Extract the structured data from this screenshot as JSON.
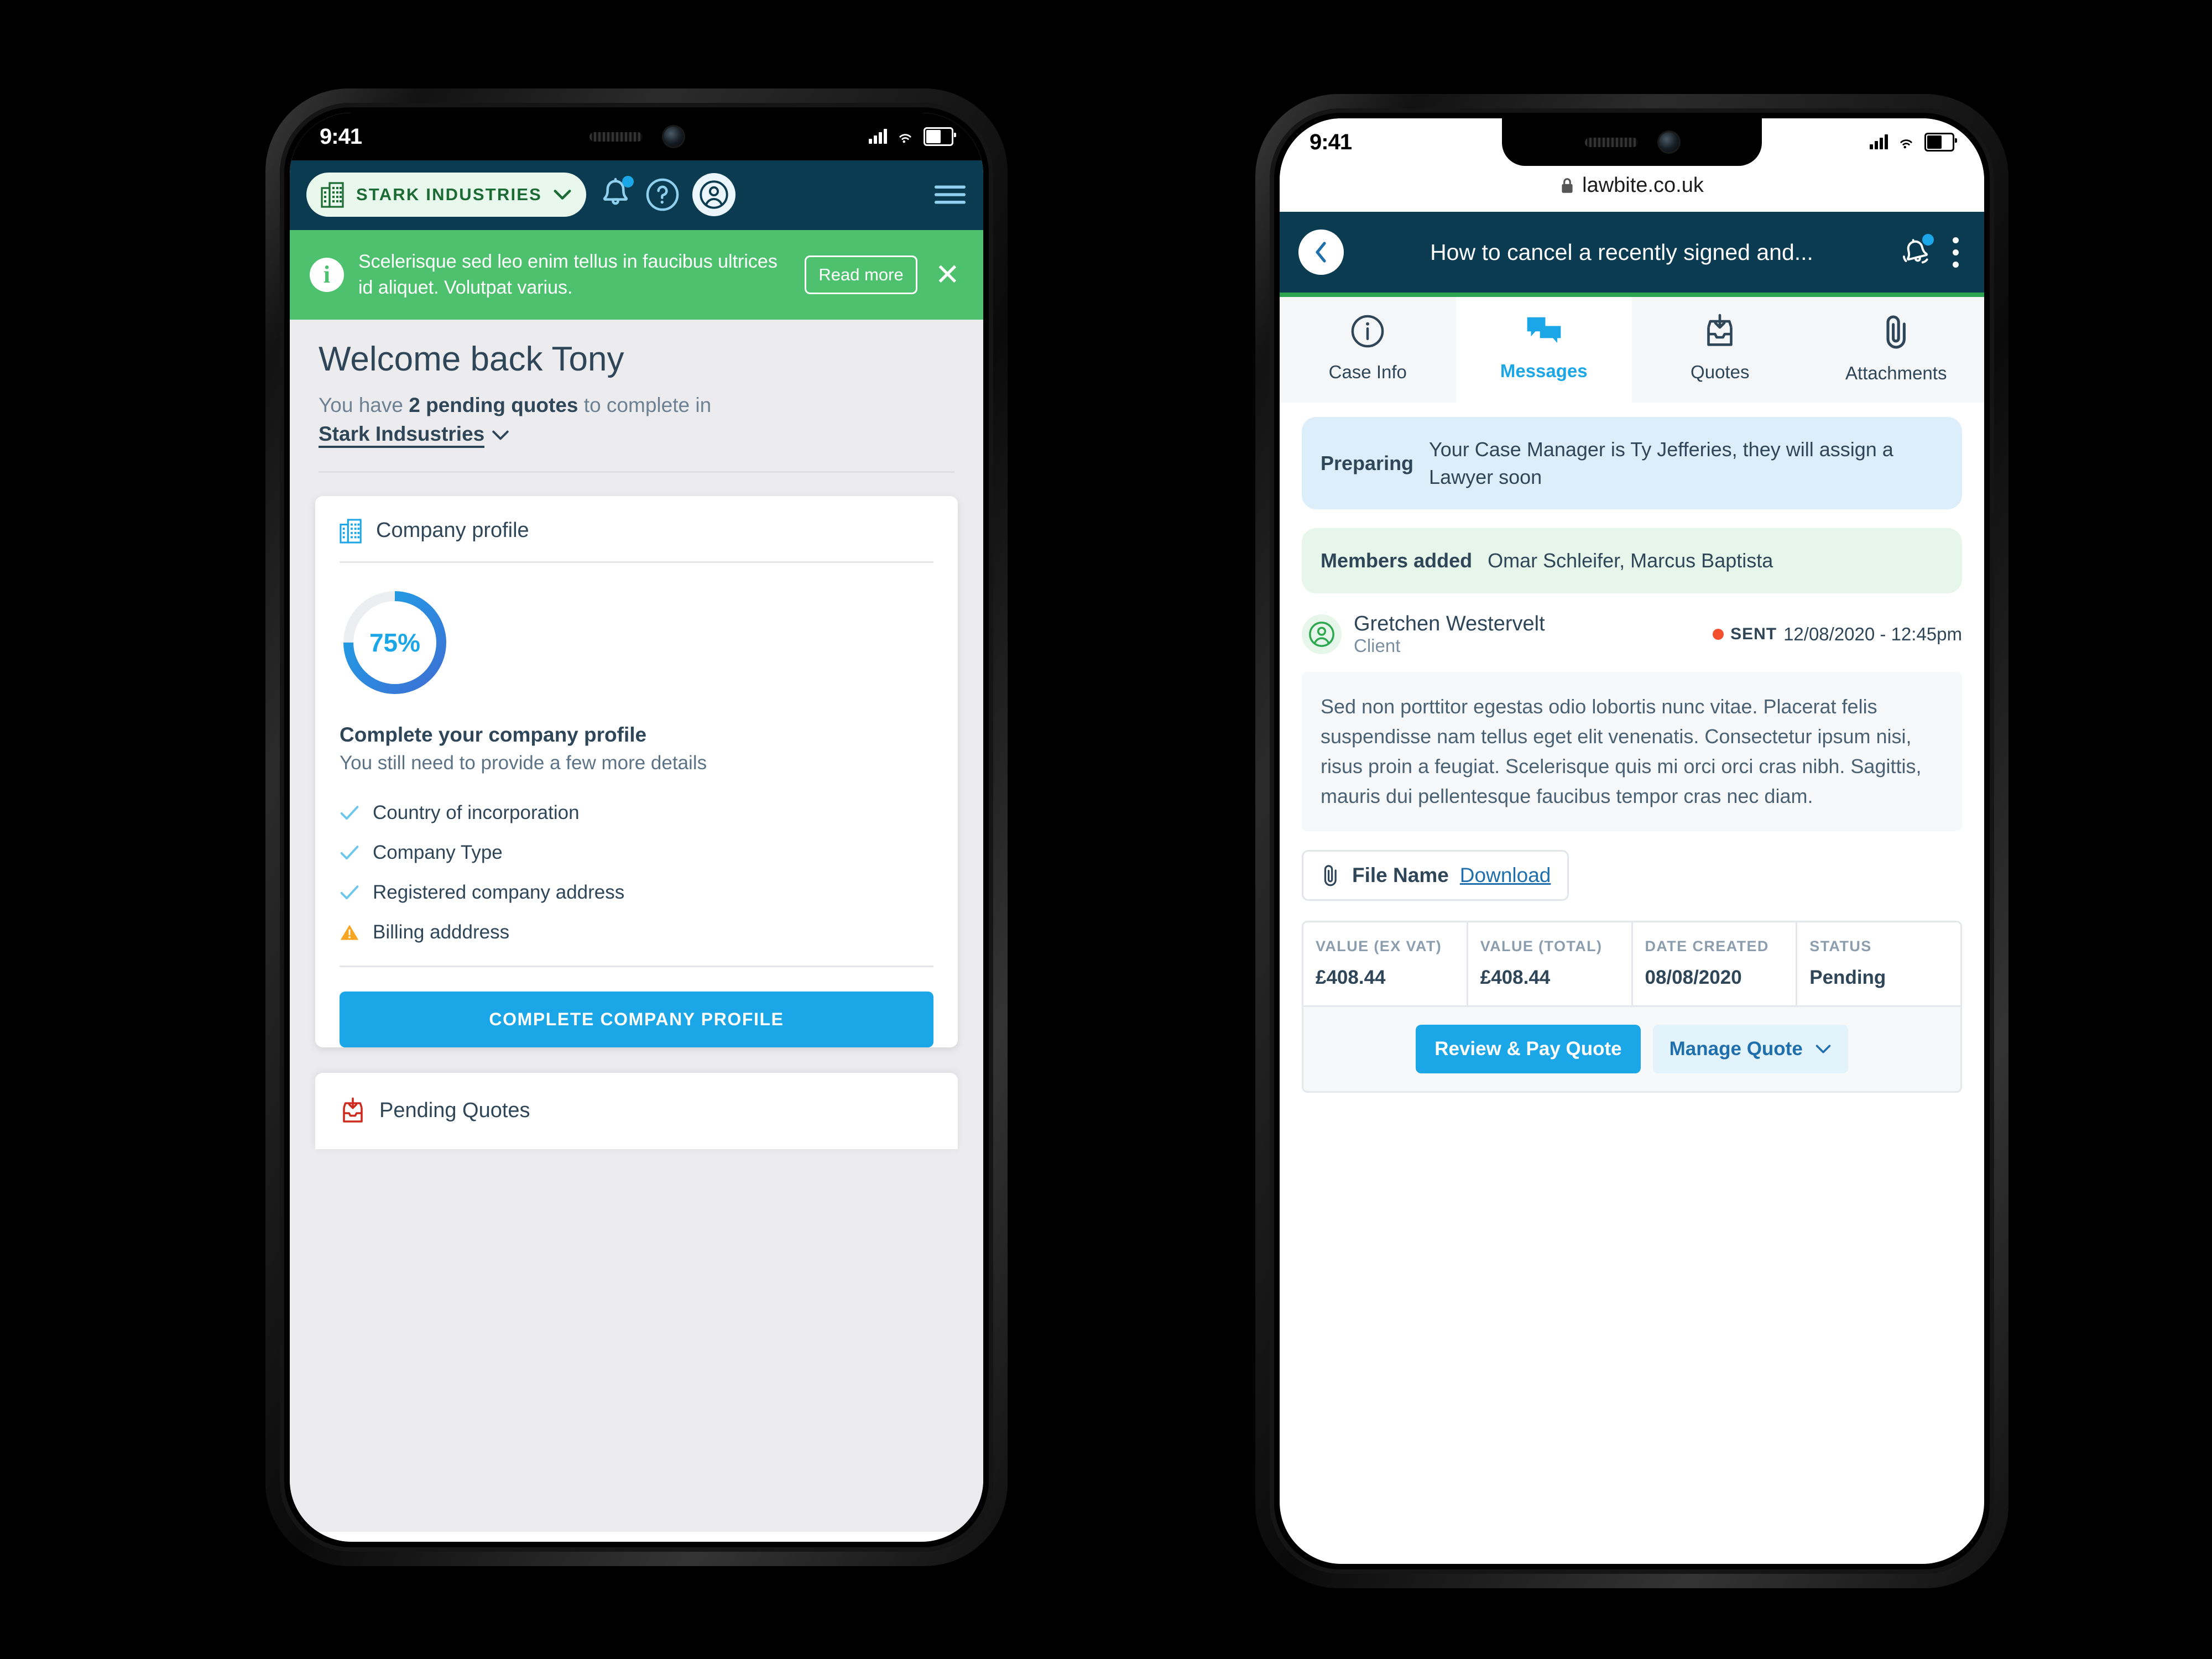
{
  "left_phone": {
    "status_bar": {
      "time": "9:41"
    },
    "app_bar": {
      "org_name": "STARK INDUSTRIES",
      "org_icon": "office-building-icon",
      "org_chevron": "chevron-down-icon",
      "bell_icon": "bell-notification-icon",
      "help_icon": "question-circle-icon",
      "avatar_icon": "user-avatar-icon",
      "menu_icon": "hamburger-menu-icon",
      "bg_color": "#0b3b50",
      "accent_color": "#8fd0ef"
    },
    "banner": {
      "info_icon": "info-circle-icon",
      "text": "Scelerisque sed leo enim tellus in faucibus ultrices id aliquet. Volutpat varius.",
      "read_more": "Read more",
      "close_icon": "close-icon",
      "bg_color": "#4ec16e"
    },
    "welcome": {
      "heading": "Welcome back Tony",
      "line_prefix": "You have ",
      "line_bold": "2 pending quotes",
      "line_suffix": " to complete in",
      "org_link": "Stark Indsustries",
      "chevron": "chevron-down-icon"
    },
    "profile_card": {
      "icon": "office-building-icon",
      "title": "Company profile",
      "progress_percent": "75%",
      "progress_value": 75,
      "progress_color_start": "#3e6fd4",
      "progress_color_end": "#1ba6e8",
      "section_heading": "Complete your company profile",
      "section_sub": "You still need to provide a few more details",
      "checklist": [
        {
          "label": "Country of incorporation",
          "state": "done",
          "icon": "check-icon"
        },
        {
          "label": "Company Type",
          "state": "done",
          "icon": "check-icon"
        },
        {
          "label": "Registered company address",
          "state": "done",
          "icon": "check-icon"
        },
        {
          "label": "Billing adddress",
          "state": "warning",
          "icon": "warning-triangle-icon"
        }
      ],
      "cta_label": "COMPLETE COMPANY PROFILE",
      "cta_color": "#1ba6e8"
    },
    "pending_card": {
      "icon": "inbox-download-icon",
      "title": "Pending Quotes",
      "icon_color": "#cc2b1d"
    }
  },
  "right_phone": {
    "status_bar": {
      "time": "9:41"
    },
    "browser": {
      "lock_icon": "lock-icon",
      "url": "lawbite.co.uk"
    },
    "app_bar": {
      "back_icon": "chevron-left-icon",
      "title": "How to cancel a recently signed and...",
      "bell_icon": "bell-notification-icon",
      "kebab_icon": "more-vertical-icon",
      "bg_color": "#0b3b50",
      "underline_color": "#2da24f"
    },
    "tabs": [
      {
        "label": "Case Info",
        "icon": "info-circle-icon",
        "active": false
      },
      {
        "label": "Messages",
        "icon": "chat-bubbles-icon",
        "active": true
      },
      {
        "label": "Quotes",
        "icon": "inbox-download-icon",
        "active": false
      },
      {
        "label": "Attachments",
        "icon": "paperclip-icon",
        "active": false
      }
    ],
    "bubbles": [
      {
        "label": "Preparing",
        "text": "Your Case Manager is Ty Jefferies, they will assign a Lawyer soon",
        "color": "#ddeefb"
      },
      {
        "label": "Members added",
        "text": "Omar Schleifer, Marcus Baptista",
        "color": "#e7f6ea"
      }
    ],
    "message": {
      "avatar_icon": "user-avatar-icon",
      "sender": "Gretchen Westervelt",
      "role": "Client",
      "unread_dot_color": "#f4502f",
      "sent_label": "SENT",
      "sent_time": "12/08/2020 - 12:45pm",
      "body": "Sed non porttitor egestas odio lobortis nunc vitae. Placerat felis suspendisse nam tellus eget elit venenatis. Consectetur ipsum nisi, risus proin a feugiat. Scelerisque quis mi orci orci cras nibh. Sagittis, mauris dui pellentesque faucibus tempor cras nec diam."
    },
    "attachment": {
      "icon": "paperclip-icon",
      "file_name": "File Name",
      "download_label": "Download"
    },
    "quote_table": {
      "columns": [
        {
          "header": "VALUE (EX VAT)",
          "value": "£408.44"
        },
        {
          "header": "VALUE (TOTAL)",
          "value": "£408.44"
        },
        {
          "header": "DATE CREATED",
          "value": "08/08/2020"
        },
        {
          "header": "STATUS",
          "value": "Pending"
        }
      ],
      "pay_button": "Review & Pay Quote",
      "manage_button": "Manage Quote",
      "manage_chevron": "chevron-down-icon"
    }
  }
}
